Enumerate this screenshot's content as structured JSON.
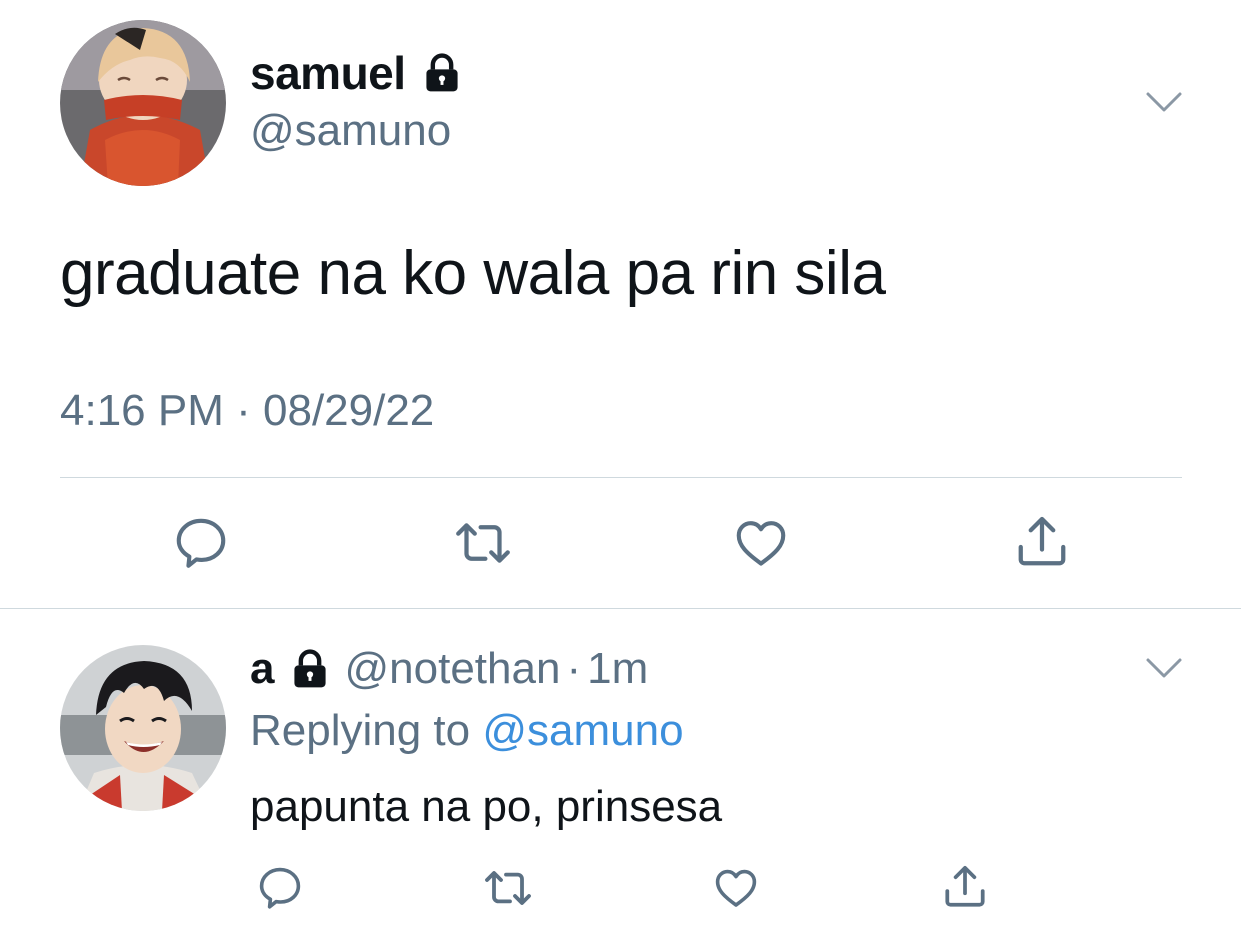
{
  "main_tweet": {
    "display_name": "samuel",
    "handle": "@samuno",
    "protected_icon": "lock-icon",
    "text": "graduate na ko wala pa rin sila",
    "time": "4:16 PM",
    "separator": "·",
    "date": "08/29/22",
    "menu_icon": "chevron-down-icon",
    "actions": [
      "reply-icon",
      "retweet-icon",
      "like-icon",
      "share-icon"
    ]
  },
  "reply_tweet": {
    "display_name": "a",
    "protected_icon": "lock-icon",
    "handle": "@notethan",
    "separator": "·",
    "time": "1m",
    "replying_prefix": "Replying to",
    "replying_to": "@samuno",
    "text": "papunta na po, prinsesa",
    "menu_icon": "chevron-down-icon",
    "actions": [
      "reply-icon",
      "retweet-icon",
      "like-icon",
      "share-icon"
    ]
  },
  "colors": {
    "text_primary": "#0f1419",
    "text_secondary": "#5b7083",
    "link": "#3c8fdc",
    "divider": "#cfd9de",
    "icon": "#5b7083"
  }
}
